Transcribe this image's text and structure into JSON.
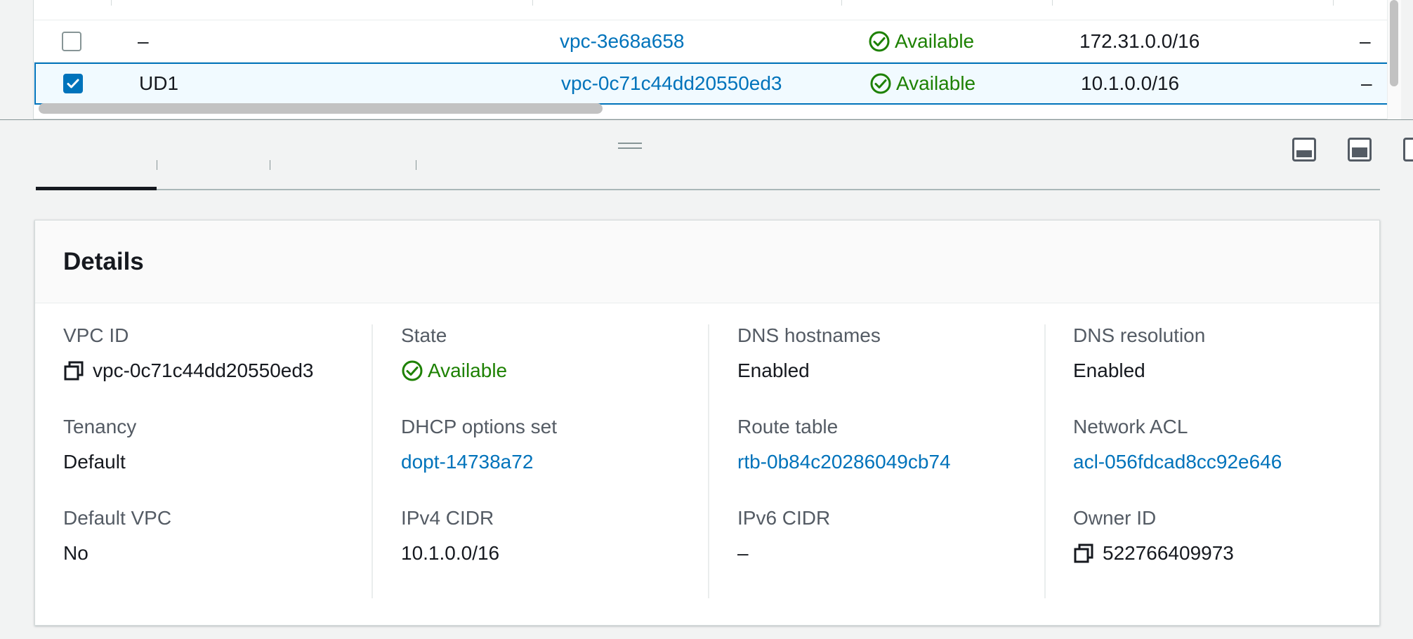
{
  "table": {
    "rows": [
      {
        "name": "–",
        "vpc_id": "vpc-3e68a658",
        "state": "Available",
        "cidr": "172.31.0.0/16",
        "extra": "–",
        "selected": false
      },
      {
        "name": "UD1",
        "vpc_id": "vpc-0c71c44dd20550ed3",
        "state": "Available",
        "cidr": "10.1.0.0/16",
        "extra": "–",
        "selected": true
      }
    ]
  },
  "details": {
    "title": "Details",
    "vpc_id": {
      "label": "VPC ID",
      "value": "vpc-0c71c44dd20550ed3"
    },
    "state": {
      "label": "State",
      "value": "Available"
    },
    "dns_hostnames": {
      "label": "DNS hostnames",
      "value": "Enabled"
    },
    "dns_resolution": {
      "label": "DNS resolution",
      "value": "Enabled"
    },
    "tenancy": {
      "label": "Tenancy",
      "value": "Default"
    },
    "dhcp_options": {
      "label": "DHCP options set",
      "value": "dopt-14738a72"
    },
    "route_table": {
      "label": "Route table",
      "value": "rtb-0b84c20286049cb74"
    },
    "network_acl": {
      "label": "Network ACL",
      "value": "acl-056fdcad8cc92e646"
    },
    "default_vpc": {
      "label": "Default VPC",
      "value": "No"
    },
    "ipv4_cidr": {
      "label": "IPv4 CIDR",
      "value": "10.1.0.0/16"
    },
    "ipv6_cidr": {
      "label": "IPv6 CIDR",
      "value": "–"
    },
    "owner_id": {
      "label": "Owner ID",
      "value": "522766409973"
    }
  },
  "colors": {
    "link": "#0073bb",
    "success": "#1d8102",
    "selected_row_bg": "#f1faff",
    "selected_border": "#0073bb"
  },
  "icons": {
    "status": "check-circle-icon",
    "copy": "copy-icon",
    "checkbox_checked": "checkmark-icon",
    "panel_bottom": "panel-bottom-icon",
    "panel_side": "panel-side-icon",
    "drag": "drag-handle-icon"
  }
}
